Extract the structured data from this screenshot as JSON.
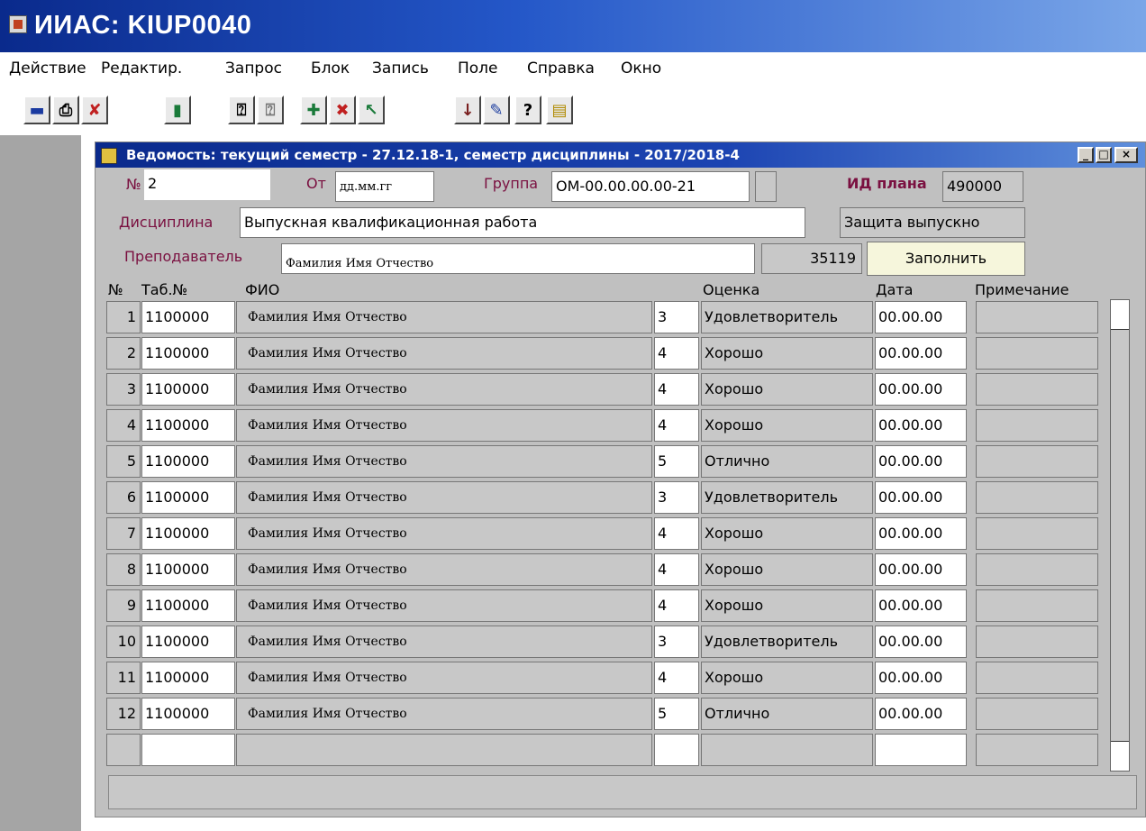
{
  "app": {
    "title": "ИИАС: KIUP0040"
  },
  "menu": [
    "Действие",
    "Редактир.",
    "Запрос",
    "Блок",
    "Запись",
    "Поле",
    "Справка",
    "Окно"
  ],
  "toolbar_icons": [
    "save-icon",
    "print-icon",
    "exit-icon",
    "door-icon",
    "query-icon",
    "query-cancel-icon",
    "insert-record-icon",
    "delete-record-icon",
    "clear-icon",
    "down-arrow-icon",
    "edit-icon",
    "help-icon",
    "document-icon"
  ],
  "toolbar_glyphs": [
    "▬",
    "⎙",
    "✘",
    "▮",
    "⍰",
    "⍰",
    "✚",
    "✖",
    "↖",
    "↓",
    "✎",
    "?",
    "▤"
  ],
  "window": {
    "title": "Ведомость: текущий семестр - 27.12.18-1, семестр дисциплины - 2017/2018-4",
    "min": "_",
    "max": "□",
    "close": "×"
  },
  "form": {
    "no_label": "№",
    "no_value": "2",
    "from_label": "От",
    "from_value": "дд.мм.гг",
    "group_label": "Группа",
    "group_value": "ОМ-00.00.00.00-21",
    "plan_label": "ИД плана",
    "plan_value": "490000",
    "discipline_label": "Дисциплина",
    "discipline_value": "Выпускная квалификационная работа",
    "defense_value": "Защита выпускно",
    "teacher_label": "Преподаватель",
    "teacher_value": "Фамилия Имя Отчество",
    "teacher_code": "35119",
    "fill_button": "Заполнить"
  },
  "table": {
    "headers": {
      "num": "№",
      "tab": "Таб.№",
      "fio": "ФИО",
      "grade": "Оценка",
      "date": "Дата",
      "note": "Примечание"
    },
    "rows": [
      {
        "num": "1",
        "tab": "1100000",
        "fio": "Фамилия Имя Отчество",
        "grade": "3",
        "grade_text": "Удовлетворитель",
        "date": "00.00.00",
        "note": ""
      },
      {
        "num": "2",
        "tab": "1100000",
        "fio": "Фамилия Имя Отчество",
        "grade": "4",
        "grade_text": "Хорошо",
        "date": "00.00.00",
        "note": ""
      },
      {
        "num": "3",
        "tab": "1100000",
        "fio": "Фамилия Имя Отчество",
        "grade": "4",
        "grade_text": "Хорошо",
        "date": "00.00.00",
        "note": ""
      },
      {
        "num": "4",
        "tab": "1100000",
        "fio": "Фамилия Имя Отчество",
        "grade": "4",
        "grade_text": "Хорошо",
        "date": "00.00.00",
        "note": ""
      },
      {
        "num": "5",
        "tab": "1100000",
        "fio": "Фамилия Имя Отчество",
        "grade": "5",
        "grade_text": "Отлично",
        "date": "00.00.00",
        "note": ""
      },
      {
        "num": "6",
        "tab": "1100000",
        "fio": "Фамилия Имя Отчество",
        "grade": "3",
        "grade_text": "Удовлетворитель",
        "date": "00.00.00",
        "note": ""
      },
      {
        "num": "7",
        "tab": "1100000",
        "fio": "Фамилия Имя Отчество",
        "grade": "4",
        "grade_text": "Хорошо",
        "date": "00.00.00",
        "note": ""
      },
      {
        "num": "8",
        "tab": "1100000",
        "fio": "Фамилия Имя Отчество",
        "grade": "4",
        "grade_text": "Хорошо",
        "date": "00.00.00",
        "note": ""
      },
      {
        "num": "9",
        "tab": "1100000",
        "fio": "Фамилия Имя Отчество",
        "grade": "4",
        "grade_text": "Хорошо",
        "date": "00.00.00",
        "note": ""
      },
      {
        "num": "10",
        "tab": "1100000",
        "fio": "Фамилия Имя Отчество",
        "grade": "3",
        "grade_text": "Удовлетворитель",
        "date": "00.00.00",
        "note": ""
      },
      {
        "num": "11",
        "tab": "1100000",
        "fio": "Фамилия Имя Отчество",
        "grade": "4",
        "grade_text": "Хорошо",
        "date": "00.00.00",
        "note": ""
      },
      {
        "num": "12",
        "tab": "1100000",
        "fio": "Фамилия Имя Отчество",
        "grade": "5",
        "grade_text": "Отлично",
        "date": "00.00.00",
        "note": ""
      },
      {
        "num": "",
        "tab": "",
        "fio": "",
        "grade": "",
        "grade_text": "",
        "date": "",
        "note": ""
      }
    ]
  }
}
